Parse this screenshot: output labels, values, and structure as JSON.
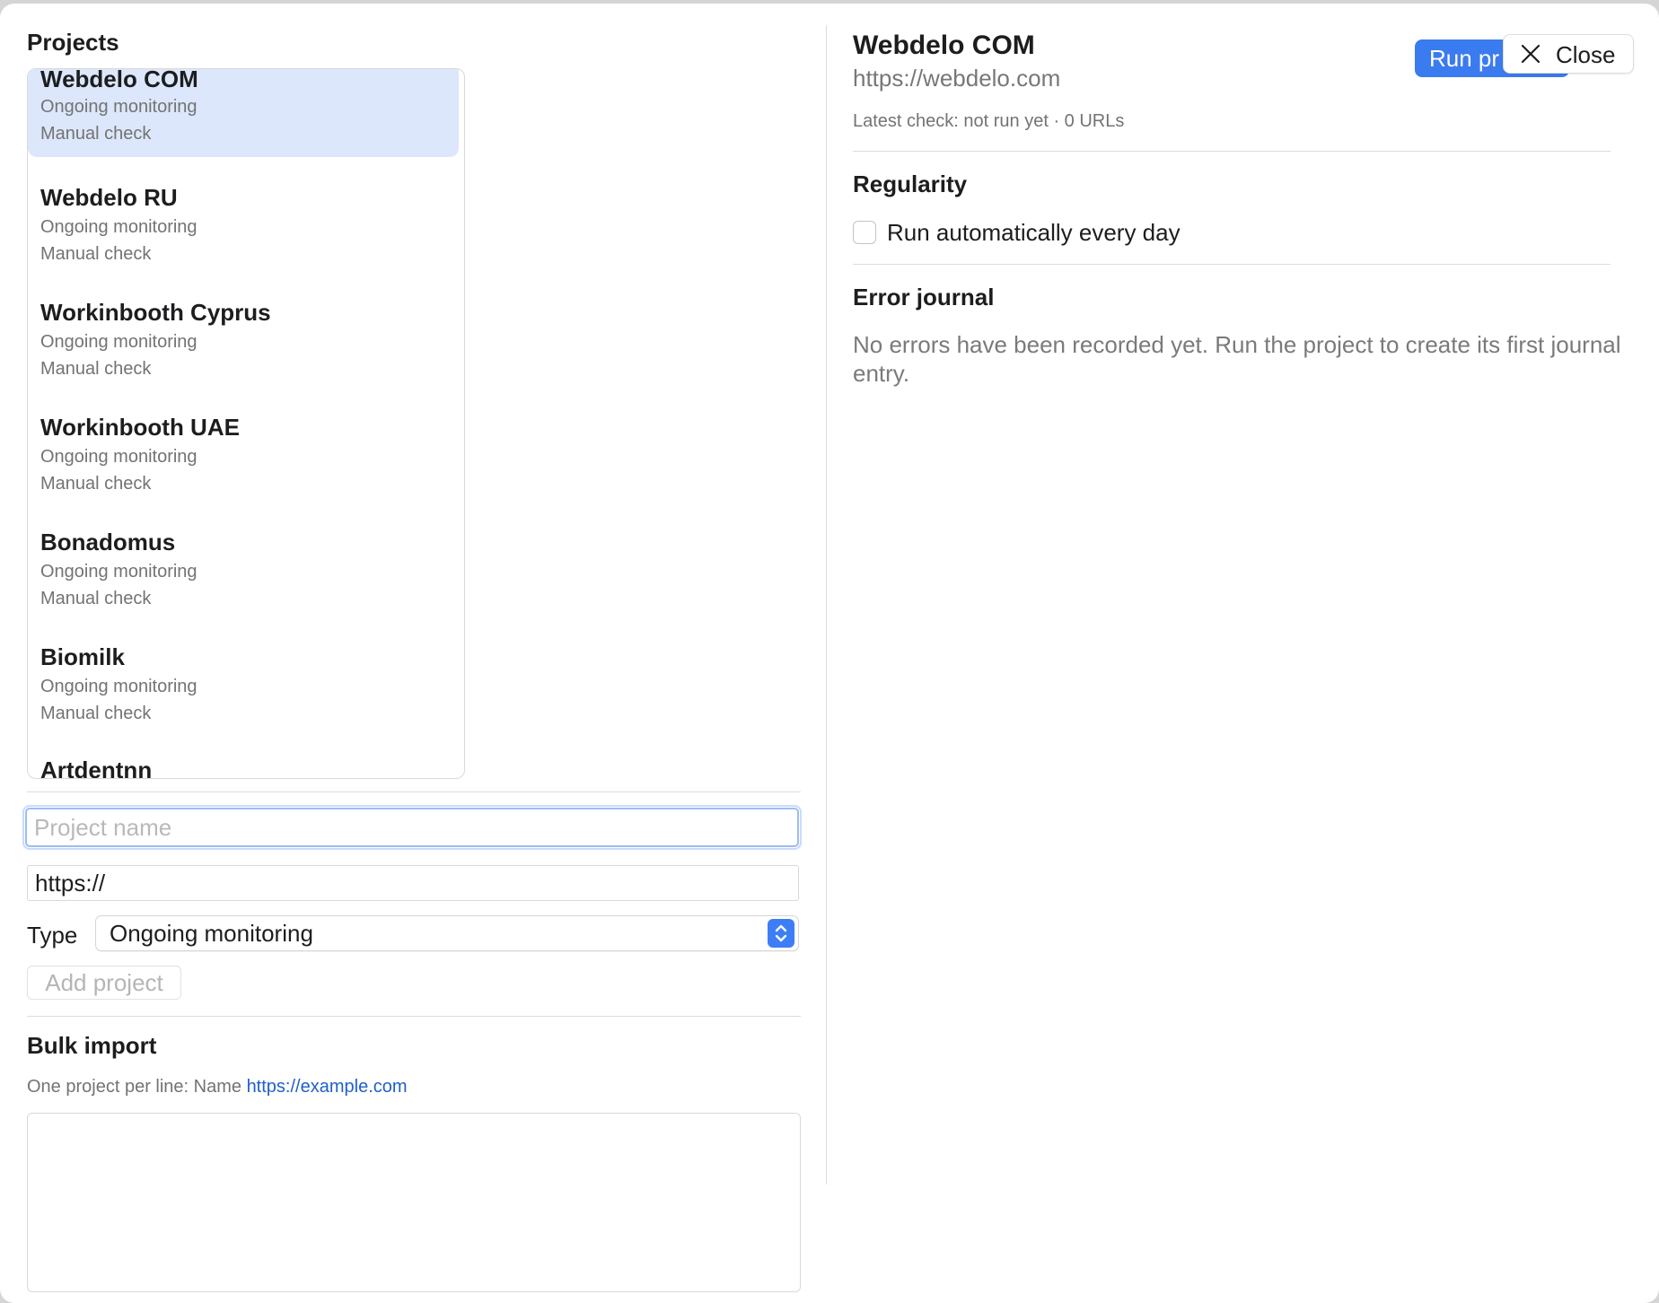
{
  "sidebar": {
    "heading": "Projects",
    "projects": [
      {
        "name": "Webdelo COM",
        "type": "Ongoing monitoring",
        "check": "Manual check",
        "selected": true
      },
      {
        "name": "Webdelo RU",
        "type": "Ongoing monitoring",
        "check": "Manual check"
      },
      {
        "name": "Workinbooth Cyprus",
        "type": "Ongoing monitoring",
        "check": "Manual check"
      },
      {
        "name": "Workinbooth UAE",
        "type": "Ongoing monitoring",
        "check": "Manual check"
      },
      {
        "name": "Bonadomus",
        "type": "Ongoing monitoring",
        "check": "Manual check"
      },
      {
        "name": "Biomilk",
        "type": "Ongoing monitoring",
        "check": "Manual check"
      },
      {
        "name": "Artdentnn"
      }
    ]
  },
  "new_project": {
    "name_placeholder": "Project name",
    "url_value": "https://",
    "type_label": "Type",
    "type_value": "Ongoing monitoring",
    "add_button": "Add project"
  },
  "bulk_import": {
    "heading": "Bulk import",
    "hint_prefix": "One project per line: Name ",
    "hint_link": "https://example.com"
  },
  "detail": {
    "title": "Webdelo COM",
    "url": "https://webdelo.com",
    "latest_check": "Latest check: not run yet · 0 URLs",
    "run_button": "Run pr",
    "close_button": "Close",
    "regularity_heading": "Regularity",
    "auto_run_label": "Run automatically every day",
    "auto_run_checked": false,
    "error_heading": "Error journal",
    "error_text": "No errors have been recorded yet. Run the project to create its first journal entry."
  },
  "colors": {
    "accent": "#3b7bf0",
    "selection": "#dce7fb",
    "link": "#2060cc"
  },
  "icons": {
    "close": "close-icon",
    "stepper": "chevron-up-down-icon"
  }
}
